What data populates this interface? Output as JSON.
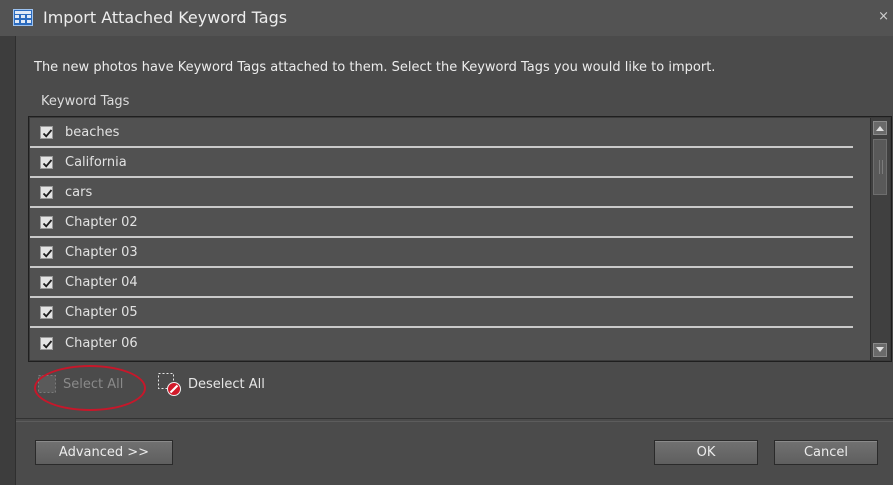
{
  "window": {
    "title": "Import Attached Keyword Tags",
    "title_icon": "grid-dialog-icon",
    "close_label": "×"
  },
  "instructions": "The new photos have Keyword Tags attached to them.  Select the Keyword Tags you would like to import.",
  "keyword_tags": {
    "label": "Keyword Tags",
    "items": [
      {
        "label": "beaches",
        "checked": true
      },
      {
        "label": "California",
        "checked": true
      },
      {
        "label": "cars",
        "checked": true
      },
      {
        "label": "Chapter 02",
        "checked": true
      },
      {
        "label": "Chapter 03",
        "checked": true
      },
      {
        "label": "Chapter 04",
        "checked": true
      },
      {
        "label": "Chapter 05",
        "checked": true
      },
      {
        "label": "Chapter 06",
        "checked": true
      }
    ]
  },
  "actions": {
    "select_all_label": "Select All",
    "select_all_enabled": false,
    "deselect_all_label": "Deselect All"
  },
  "buttons": {
    "advanced_label": "Advanced >>",
    "ok_label": "OK",
    "cancel_label": "Cancel"
  },
  "colors": {
    "highlight_ring": "#c7172a",
    "dialog_bg": "#4b4b4b",
    "titlebar_bg": "#535353"
  }
}
